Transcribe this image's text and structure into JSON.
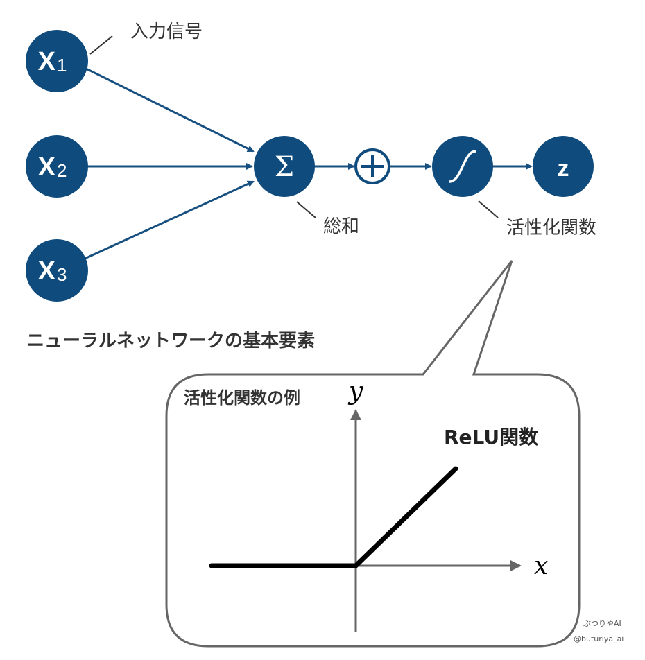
{
  "colors": {
    "node": "#0f4c7d",
    "edge": "#164f80",
    "text": "#333333",
    "bubble": "#666666",
    "plot_line": "#000000",
    "axis": "#666666"
  },
  "nodes": {
    "x1": {
      "base": "X",
      "sub": "1"
    },
    "x2": {
      "base": "X",
      "sub": "2"
    },
    "x3": {
      "base": "X",
      "sub": "3"
    },
    "sum": {
      "symbol": "Σ"
    },
    "bias": {
      "symbol": "+"
    },
    "activation": {
      "symbol": "∫",
      "icon": "sigmoid-curve-icon"
    },
    "output": {
      "label": "z"
    }
  },
  "labels": {
    "input_signal": "入力信号",
    "sum": "総和",
    "activation_function": "活性化関数",
    "caption": "ニューラルネットワークの基本要素"
  },
  "callout": {
    "title": "活性化関数の例",
    "y_axis": "y",
    "x_axis": "x",
    "function_name": "ReLU関数"
  },
  "watermark": {
    "line1": "ぶつりやAI",
    "line2": "@buturiya_ai"
  }
}
